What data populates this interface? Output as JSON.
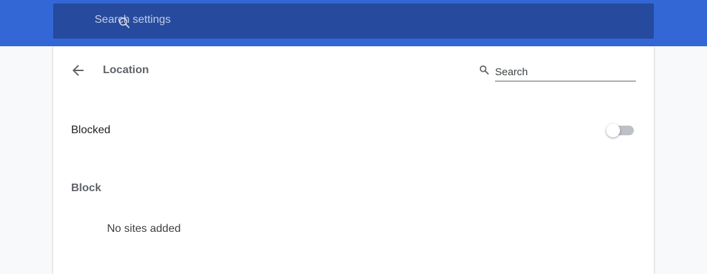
{
  "header": {
    "search_placeholder": "Search settings",
    "band_color": "#3367d6",
    "bar_color": "#264a9e",
    "search_icon": "search-icon"
  },
  "page": {
    "title": "Location",
    "back_icon": "arrow-back-icon",
    "search_placeholder": "Search",
    "search_icon": "search-icon"
  },
  "setting": {
    "label": "Blocked",
    "toggle_on": false
  },
  "block_section": {
    "heading": "Block",
    "empty_text": "No sites added"
  }
}
